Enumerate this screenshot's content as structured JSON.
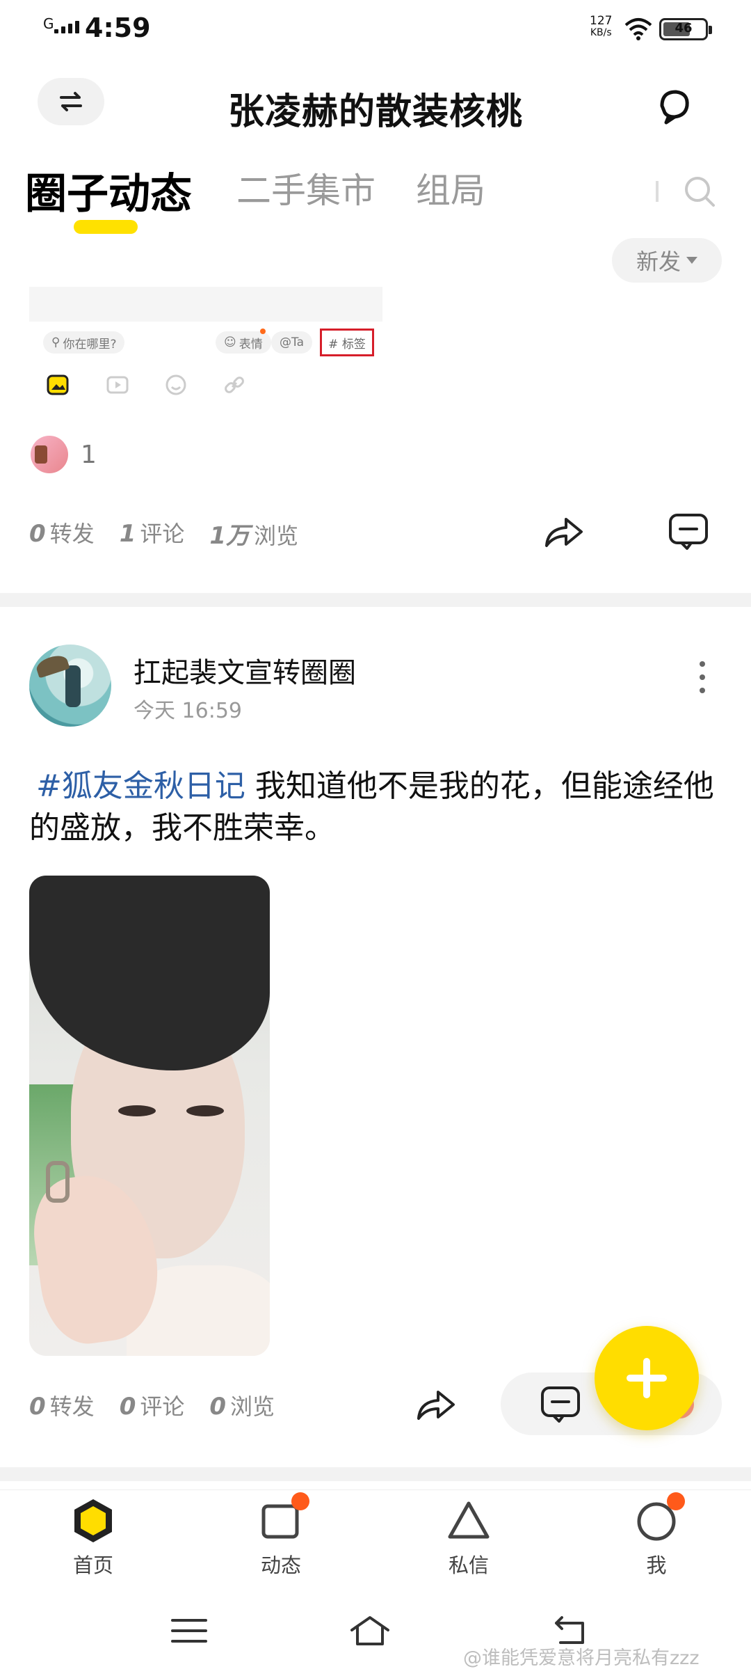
{
  "status_bar": {
    "network": "G",
    "time": "4:59",
    "speed_value": "127",
    "speed_unit": "KB/s",
    "battery": "46"
  },
  "header": {
    "title": "张凌赫的散装核桃",
    "switch_icon": "swap-arrows-icon",
    "notify_icon": "bell-icon"
  },
  "tabs": [
    {
      "label": "圈子动态",
      "active": true
    },
    {
      "label": "二手集市",
      "active": false
    },
    {
      "label": "组局",
      "active": false
    }
  ],
  "sort": {
    "label": "新发"
  },
  "composer_snippet": {
    "location": "你在哪里?",
    "emoji": "表情",
    "mention": "@Ta",
    "tag": "# 标签"
  },
  "previous_post": {
    "like_count": "1",
    "repost_count": "0",
    "repost_label": "转发",
    "comment_count": "1",
    "comment_label": "评论",
    "view_count": "1万",
    "view_label": "浏览"
  },
  "post": {
    "author": "扛起裴文宣转圈圈",
    "time": "今天 16:59",
    "hashtag": "#狐友金秋日记",
    "text": "我知道他不是我的花，但能途经他的盛放，我不胜荣幸。",
    "repost_count": "0",
    "repost_label": "转发",
    "comment_count": "0",
    "comment_label": "评论",
    "view_count": "0",
    "view_label": "浏览"
  },
  "bottom_nav": [
    {
      "label": "首页",
      "icon": "hexagon-home-icon",
      "badge": false
    },
    {
      "label": "动态",
      "icon": "square-feed-icon",
      "badge": true
    },
    {
      "label": "私信",
      "icon": "triangle-message-icon",
      "badge": false
    },
    {
      "label": "我",
      "icon": "circle-profile-icon",
      "badge": true
    }
  ],
  "watermark": "@谁能凭爱意将月亮私有zzz",
  "colors": {
    "accent": "#ffdd00",
    "hashtag": "#2d5fa6",
    "badge": "#ff5a1a",
    "tag_outline": "#d61e2a"
  }
}
